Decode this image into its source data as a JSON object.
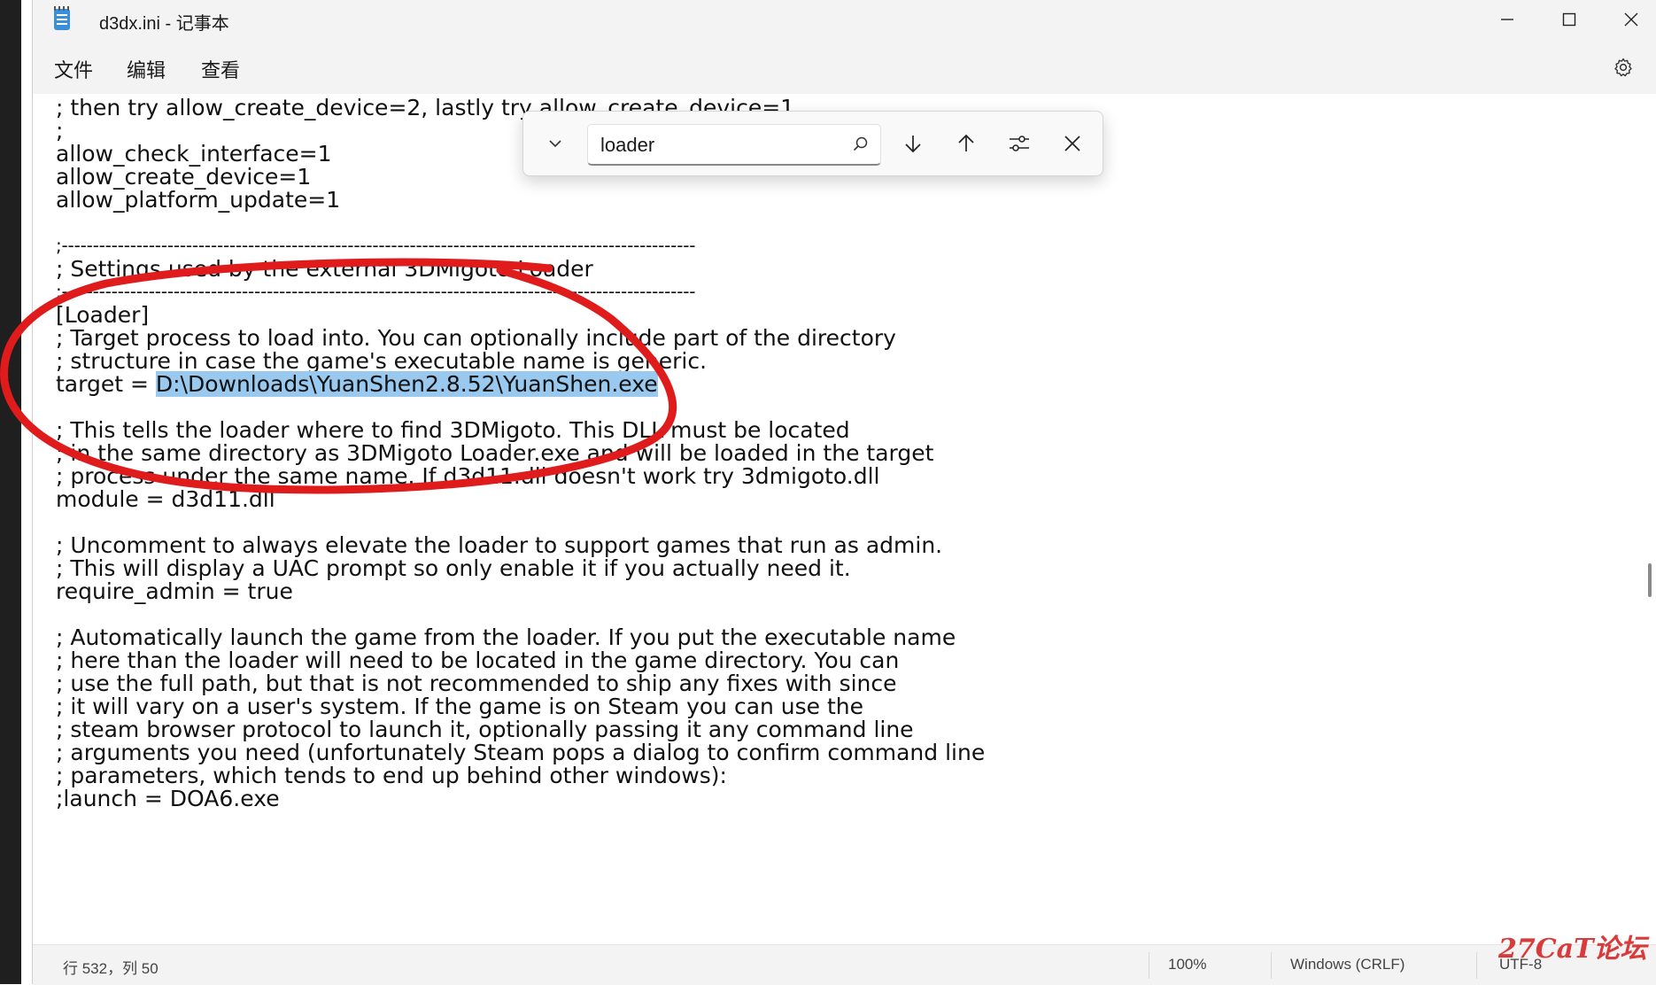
{
  "window": {
    "title": "d3dx.ini - 记事本"
  },
  "menu": {
    "file": "文件",
    "edit": "编辑",
    "view": "查看"
  },
  "find": {
    "query": "loader"
  },
  "lines": [
    "; then try allow_create_device=2, lastly try allow_create_device=1",
    ";",
    "allow_check_interface=1",
    "allow_create_device=1",
    "allow_platform_update=1",
    "",
    ";------------------------------------------------------------------------------------------------------",
    "; Settings used by the external 3DMigoto Loader",
    ";------------------------------------------------------------------------------------------------------",
    "[Loader]",
    "; Target process to load into. You can optionally include part of the directory",
    "; structure in case the game's executable name is generic.",
    "target = ",
    "",
    "; This tells the loader where to find 3DMigoto. This DLL must be located",
    "; in the same directory as 3DMigoto Loader.exe and will be loaded in the target",
    "; process under the same name. If d3d11.dll doesn't work try 3dmigoto.dll",
    "module = d3d11.dll",
    "",
    "; Uncomment to always elevate the loader to support games that run as admin.",
    "; This will display a UAC prompt so only enable it if you actually need it.",
    "require_admin = true",
    "",
    "; Automatically launch the game from the loader. If you put the executable name",
    "; here than the loader will need to be located in the game directory. You can",
    "; use the full path, but that is not recommended to ship any fixes with since",
    "; it will vary on a user's system. If the game is on Steam you can use the",
    "; steam browser protocol to launch it, optionally passing it any command line",
    "; arguments you need (unfortunately Steam pops a dialog to confirm command line",
    "; parameters, which tends to end up behind other windows):",
    ";launch = DOA6.exe"
  ],
  "selection": "D:\\Downloads\\YuanShen2.8.52\\YuanShen.exe",
  "status": {
    "position": "行 532，列 50",
    "zoom": "100%",
    "line_ending": "Windows (CRLF)",
    "encoding": "UTF-8"
  },
  "watermark": "27CaT论坛",
  "colors": {
    "selection": "#99c9ef",
    "annotation": "#e01b1b",
    "chrome": "#f3f3f3"
  }
}
